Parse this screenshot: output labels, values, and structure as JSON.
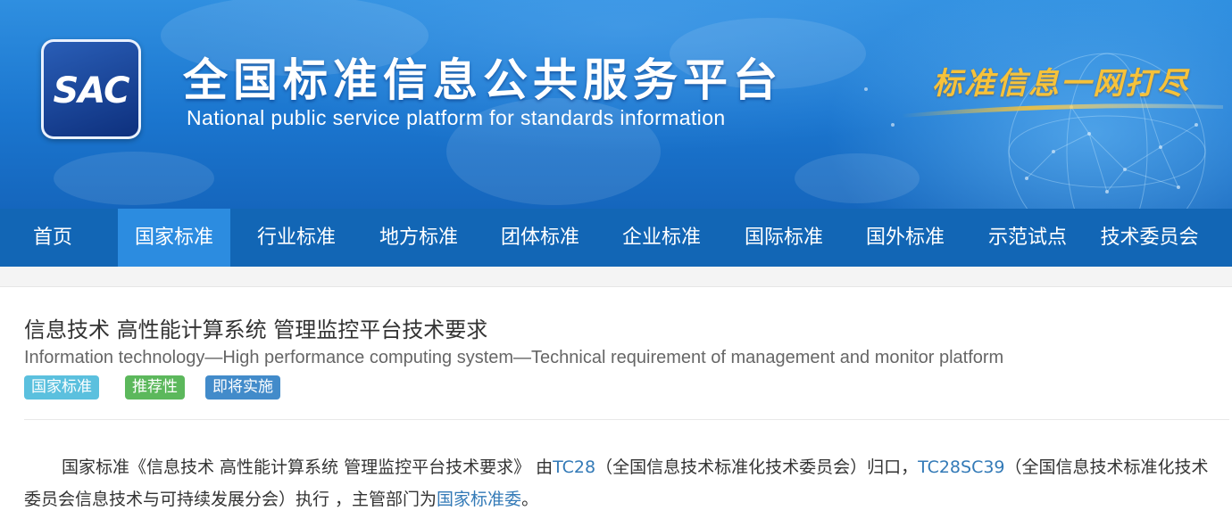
{
  "header": {
    "logo_text": "SAC",
    "title_cn": "全国标准信息公共服务平台",
    "title_en": "National public service platform  for standards information",
    "slogan": "标准信息一网打尽"
  },
  "nav": {
    "items": [
      {
        "label": "首页"
      },
      {
        "label": "国家标准"
      },
      {
        "label": "行业标准"
      },
      {
        "label": "地方标准"
      },
      {
        "label": "团体标准"
      },
      {
        "label": "企业标准"
      },
      {
        "label": "国际标准"
      },
      {
        "label": "国外标准"
      },
      {
        "label": "示范试点"
      },
      {
        "label": "技术委员会"
      }
    ],
    "active_label": "国家标准"
  },
  "standard": {
    "title_cn": "信息技术 高性能计算系统 管理监控平台技术要求",
    "title_en": "Information technology—High performance computing system—Technical requirement of management and monitor platform",
    "badges": [
      {
        "label": "国家标准",
        "color": "#5bc0de"
      },
      {
        "label": "推荐性",
        "color": "#5cb85c"
      },
      {
        "label": "即将实施",
        "color": "#428bca"
      }
    ],
    "description": {
      "part1": "国家标准《信息技术 高性能计算系统 管理监控平台技术要求》 由",
      "tc_link": "TC28",
      "part2": "（全国信息技术标准化技术委员会）归口，",
      "sc_link": "TC28SC39",
      "part3": "（全国信息技术标准化技术委员会信息技术与可持续发展分会）执行 ，主管部门为",
      "dept_link": "国家标准委",
      "part4": "。"
    }
  },
  "colors": {
    "nav_bg": "#1266b5",
    "nav_active": "#2c8ce0",
    "link": "#337ab7",
    "slogan": "#f6c23a"
  }
}
